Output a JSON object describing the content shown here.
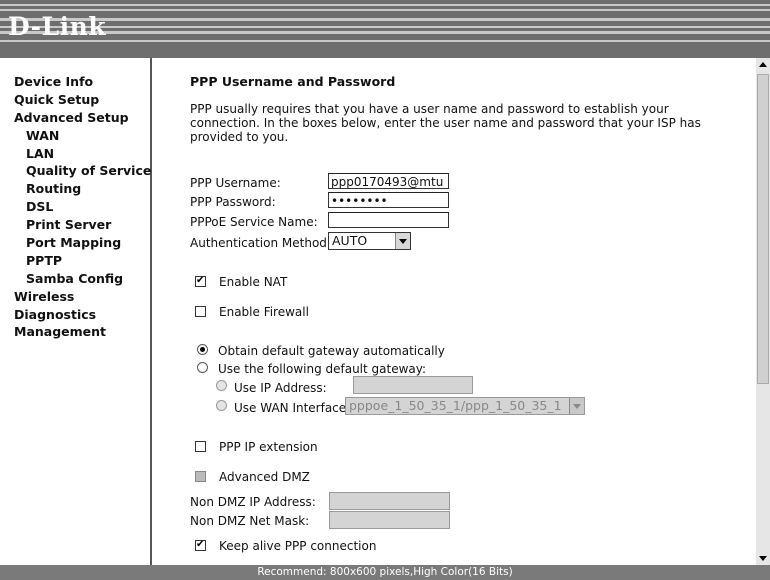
{
  "header": {
    "logo": "D-Link"
  },
  "sidebar": {
    "items": [
      {
        "label": "Device Info",
        "sub": false
      },
      {
        "label": "Quick Setup",
        "sub": false
      },
      {
        "label": "Advanced Setup",
        "sub": false
      },
      {
        "label": "WAN",
        "sub": true
      },
      {
        "label": "LAN",
        "sub": true
      },
      {
        "label": "Quality of Service",
        "sub": true
      },
      {
        "label": "Routing",
        "sub": true
      },
      {
        "label": "DSL",
        "sub": true
      },
      {
        "label": "Print Server",
        "sub": true
      },
      {
        "label": "Port Mapping",
        "sub": true
      },
      {
        "label": "PPTP",
        "sub": true
      },
      {
        "label": "Samba Config",
        "sub": true
      },
      {
        "label": "Wireless",
        "sub": false
      },
      {
        "label": "Diagnostics",
        "sub": false
      },
      {
        "label": "Management",
        "sub": false
      }
    ]
  },
  "main": {
    "title": "PPP Username and Password",
    "description": "PPP usually requires that you have a user name and password to establish your connection. In the boxes below, enter the user name and password that your ISP has provided to you.",
    "fields": {
      "username_label": "PPP Username:",
      "username_value": "ppp0170493@mtu",
      "password_label": "PPP Password:",
      "password_value": "••••••••",
      "service_label": "PPPoE Service Name:",
      "service_value": "",
      "auth_label": "Authentication Method:",
      "auth_value": "AUTO"
    },
    "options": {
      "enable_nat": "Enable NAT",
      "enable_firewall": "Enable Firewall",
      "gateway_auto": "Obtain default gateway automatically",
      "gateway_manual": "Use the following default gateway:",
      "use_ip": "Use IP Address:",
      "use_wan": "Use WAN Interface:",
      "wan_interface_value": "pppoe_1_50_35_1/ppp_1_50_35_1",
      "ppp_ip_ext": "PPP IP extension",
      "advanced_dmz": "Advanced DMZ",
      "non_dmz_ip": "Non DMZ IP Address:",
      "non_dmz_mask": "Non DMZ Net Mask:",
      "keep_alive": "Keep alive PPP connection"
    }
  },
  "footer": {
    "text": "Recommend: 800x600 pixels,High Color(16 Bits)"
  }
}
